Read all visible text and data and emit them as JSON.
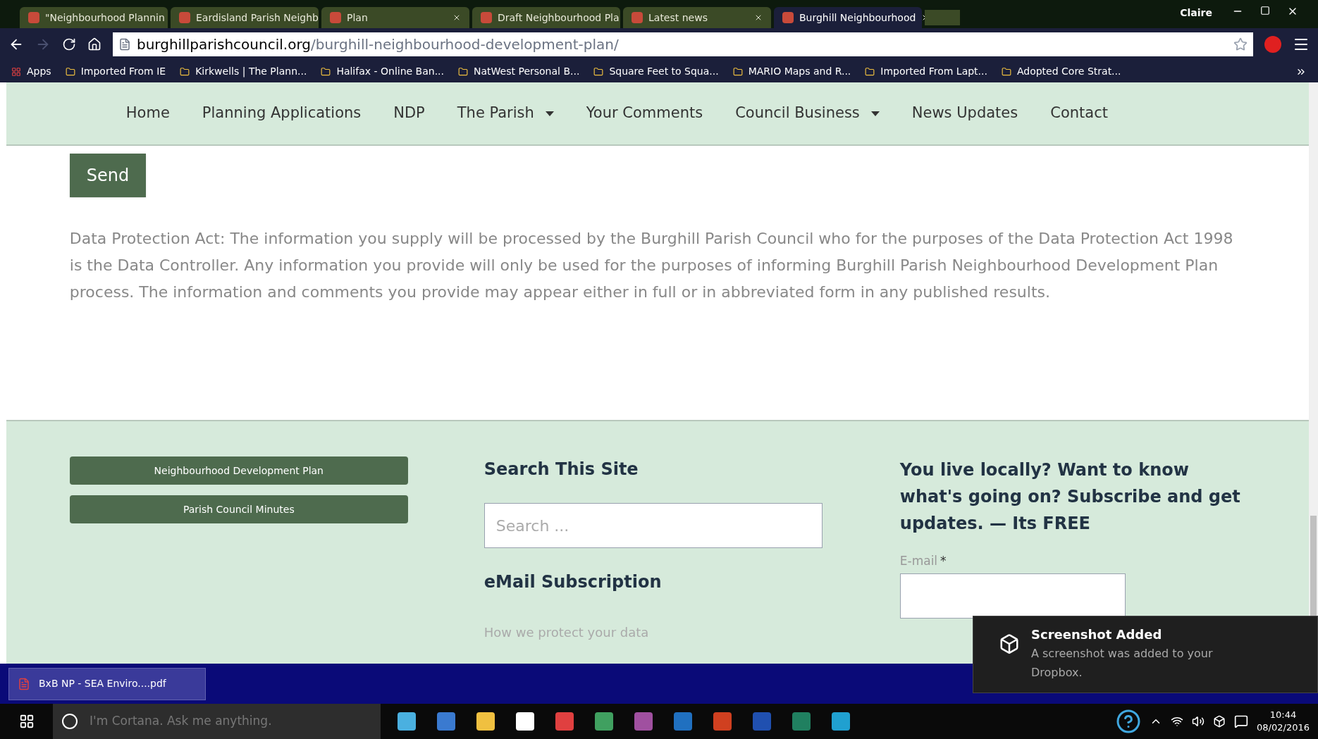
{
  "browser": {
    "tabs": [
      {
        "title": "\"Neighbourhood Plannin",
        "selected": false
      },
      {
        "title": "Eardisland Parish Neighb",
        "selected": false
      },
      {
        "title": "Plan",
        "selected": false
      },
      {
        "title": "Draft Neighbourhood Pla",
        "selected": false
      },
      {
        "title": "Latest news",
        "selected": false
      },
      {
        "title": "Burghill Neighbourhood",
        "selected": true
      }
    ],
    "profile": "Claire",
    "url_domain": "burghillparishcouncil.org",
    "url_path": "/burghill-neighbourhood-development-plan/",
    "bookmarks": [
      "Apps",
      "Imported From IE",
      "Kirkwells | The Plann...",
      "Halifax - Online Ban...",
      "NatWest Personal B...",
      "Square Feet to Squa...",
      "MARIO Maps and R...",
      "Imported From Lapt...",
      "Adopted Core Strat..."
    ]
  },
  "nav": [
    {
      "label": "Home",
      "dropdown": false
    },
    {
      "label": "Planning Applications",
      "dropdown": false
    },
    {
      "label": "NDP",
      "dropdown": false
    },
    {
      "label": "The Parish",
      "dropdown": true
    },
    {
      "label": "Your Comments",
      "dropdown": false
    },
    {
      "label": "Council Business",
      "dropdown": true
    },
    {
      "label": "News Updates",
      "dropdown": false
    },
    {
      "label": "Contact",
      "dropdown": false
    }
  ],
  "send_button": "Send",
  "data_protection": "Data Protection Act: The information you supply will be processed by the Burghill Parish Council who for the purposes of the Data Protection Act 1998 is the Data Controller. Any information you provide will only be used for the purposes of informing Burghill Parish Neighbourhood Development Plan process. The information and comments you provide may appear either in full or in abbreviated form in any published results.",
  "footer": {
    "links": [
      "Neighbourhood Development Plan",
      "Parish Council Minutes"
    ],
    "search_title": "Search This Site",
    "search_placeholder": "Search ...",
    "email_title": "eMail Subscription",
    "privacy_link": "How we protect your data",
    "subscribe_text": "You live locally? Want to know what's going on? Subscribe and get updates. — Its FREE",
    "email_label": "E-mail",
    "required_mark": "*"
  },
  "download": {
    "file": "BxB NP - SEA Enviro....pdf"
  },
  "notification": {
    "title": "Screenshot Added",
    "body": "A screenshot was added to your Dropbox."
  },
  "taskbar": {
    "search_placeholder": "I'm Cortana. Ask me anything.",
    "time": "10:44",
    "date": "08/02/2016"
  }
}
